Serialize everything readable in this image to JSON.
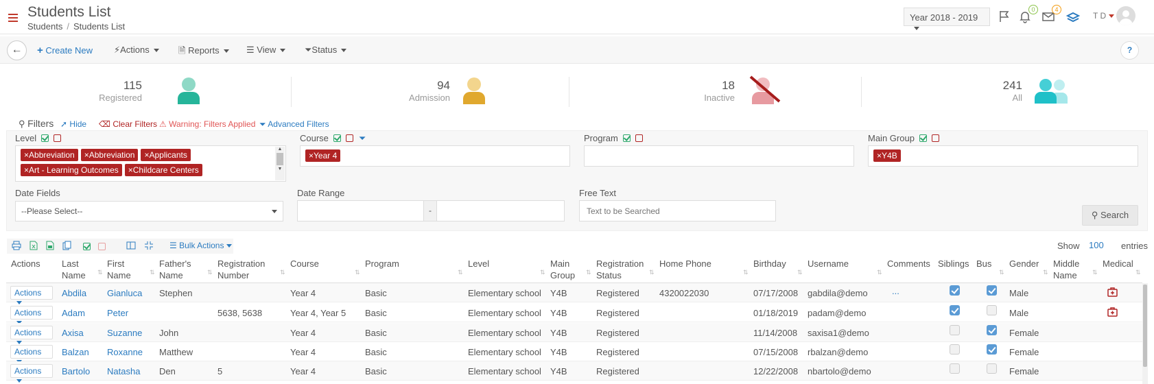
{
  "header": {
    "title": "Students List",
    "breadcrumb": [
      "Students",
      "Students List"
    ],
    "year": "Year 2018 - 2019",
    "notifications_count": "0",
    "messages_count": "4",
    "user_initials": "T D"
  },
  "toolbar": {
    "create_new": "Create New",
    "actions": "Actions",
    "reports": "Reports",
    "view": "View",
    "status": "Status",
    "help": "?"
  },
  "stats": [
    {
      "count": "115",
      "label": "Registered",
      "color": "#26b59a"
    },
    {
      "count": "94",
      "label": "Admission",
      "color": "#e0a82e"
    },
    {
      "count": "18",
      "label": "Inactive",
      "color": "#e79aa0"
    },
    {
      "count": "241",
      "label": "All",
      "color": "#1fc0c8"
    }
  ],
  "filters": {
    "title": "Filters",
    "hide": "Hide",
    "clear": "Clear Filters",
    "warning": "Warning: Filters Applied",
    "advanced": "Advanced Filters",
    "level_label": "Level",
    "level_tags": [
      "Abbreviation",
      "Abbreviation",
      "Applicants",
      "Art - Learning Outcomes",
      "Childcare Centers"
    ],
    "course_label": "Course",
    "course_tags": [
      "Year 4"
    ],
    "program_label": "Program",
    "main_group_label": "Main Group",
    "main_group_tags": [
      "Y4B"
    ],
    "date_fields_label": "Date Fields",
    "date_fields_value": "--Please Select--",
    "date_range_label": "Date Range",
    "date_range_sep": "-",
    "free_text_label": "Free Text",
    "free_text_placeholder": "Text to be Searched",
    "search": "Search"
  },
  "table_tools": {
    "bulk_actions": "Bulk Actions",
    "show_label": "Show",
    "show_value": "100",
    "entries_label": "entries"
  },
  "table": {
    "headers": [
      "Actions",
      "Last Name",
      "First Name",
      "Father's Name",
      "Registration Number",
      "Course",
      "Program",
      "Level",
      "Main Group",
      "Registration Status",
      "Home Phone",
      "Birthday",
      "Username",
      "Comments",
      "Siblings",
      "Bus",
      "Gender",
      "Middle Name",
      "Medical"
    ],
    "action_label": "Actions",
    "rows": [
      {
        "last": "Abdila",
        "first": "Gianluca",
        "father": "Stephen",
        "reg": "",
        "course": "Year 4",
        "program": "Basic",
        "level": "Elementary school",
        "group": "Y4B",
        "status": "Registered",
        "phone": "4320022030",
        "birthday": "07/17/2008",
        "username": "gabdila@demo",
        "comments": "...",
        "siblings": true,
        "bus": true,
        "gender": "Male",
        "medical": true
      },
      {
        "last": "Adam",
        "first": "Peter",
        "father": "",
        "reg": "5638, 5638",
        "course": "Year 4, Year 5",
        "program": "Basic",
        "level": "Elementary school",
        "group": "Y4B",
        "status": "Registered",
        "phone": "",
        "birthday": "01/18/2019",
        "username": "padam@demo",
        "comments": "",
        "siblings": true,
        "bus": false,
        "gender": "Male",
        "medical": true
      },
      {
        "last": "Axisa",
        "first": "Suzanne",
        "father": "John",
        "reg": "",
        "course": "Year 4",
        "program": "Basic",
        "level": "Elementary school",
        "group": "Y4B",
        "status": "Registered",
        "phone": "",
        "birthday": "11/14/2008",
        "username": "saxisa1@demo",
        "comments": "",
        "siblings": false,
        "bus": true,
        "gender": "Female",
        "medical": false
      },
      {
        "last": "Balzan",
        "first": "Roxanne",
        "father": "Matthew",
        "reg": "",
        "course": "Year 4",
        "program": "Basic",
        "level": "Elementary school",
        "group": "Y4B",
        "status": "Registered",
        "phone": "",
        "birthday": "07/15/2008",
        "username": "rbalzan@demo",
        "comments": "",
        "siblings": false,
        "bus": true,
        "gender": "Female",
        "medical": false
      },
      {
        "last": "Bartolo",
        "first": "Natasha",
        "father": "Den",
        "reg": "5",
        "course": "Year 4",
        "program": "Basic",
        "level": "Elementary school",
        "group": "Y4B",
        "status": "Registered",
        "phone": "",
        "birthday": "12/22/2008",
        "username": "nbartolo@demo",
        "comments": "",
        "siblings": false,
        "bus": false,
        "gender": "Female",
        "medical": false
      }
    ]
  }
}
